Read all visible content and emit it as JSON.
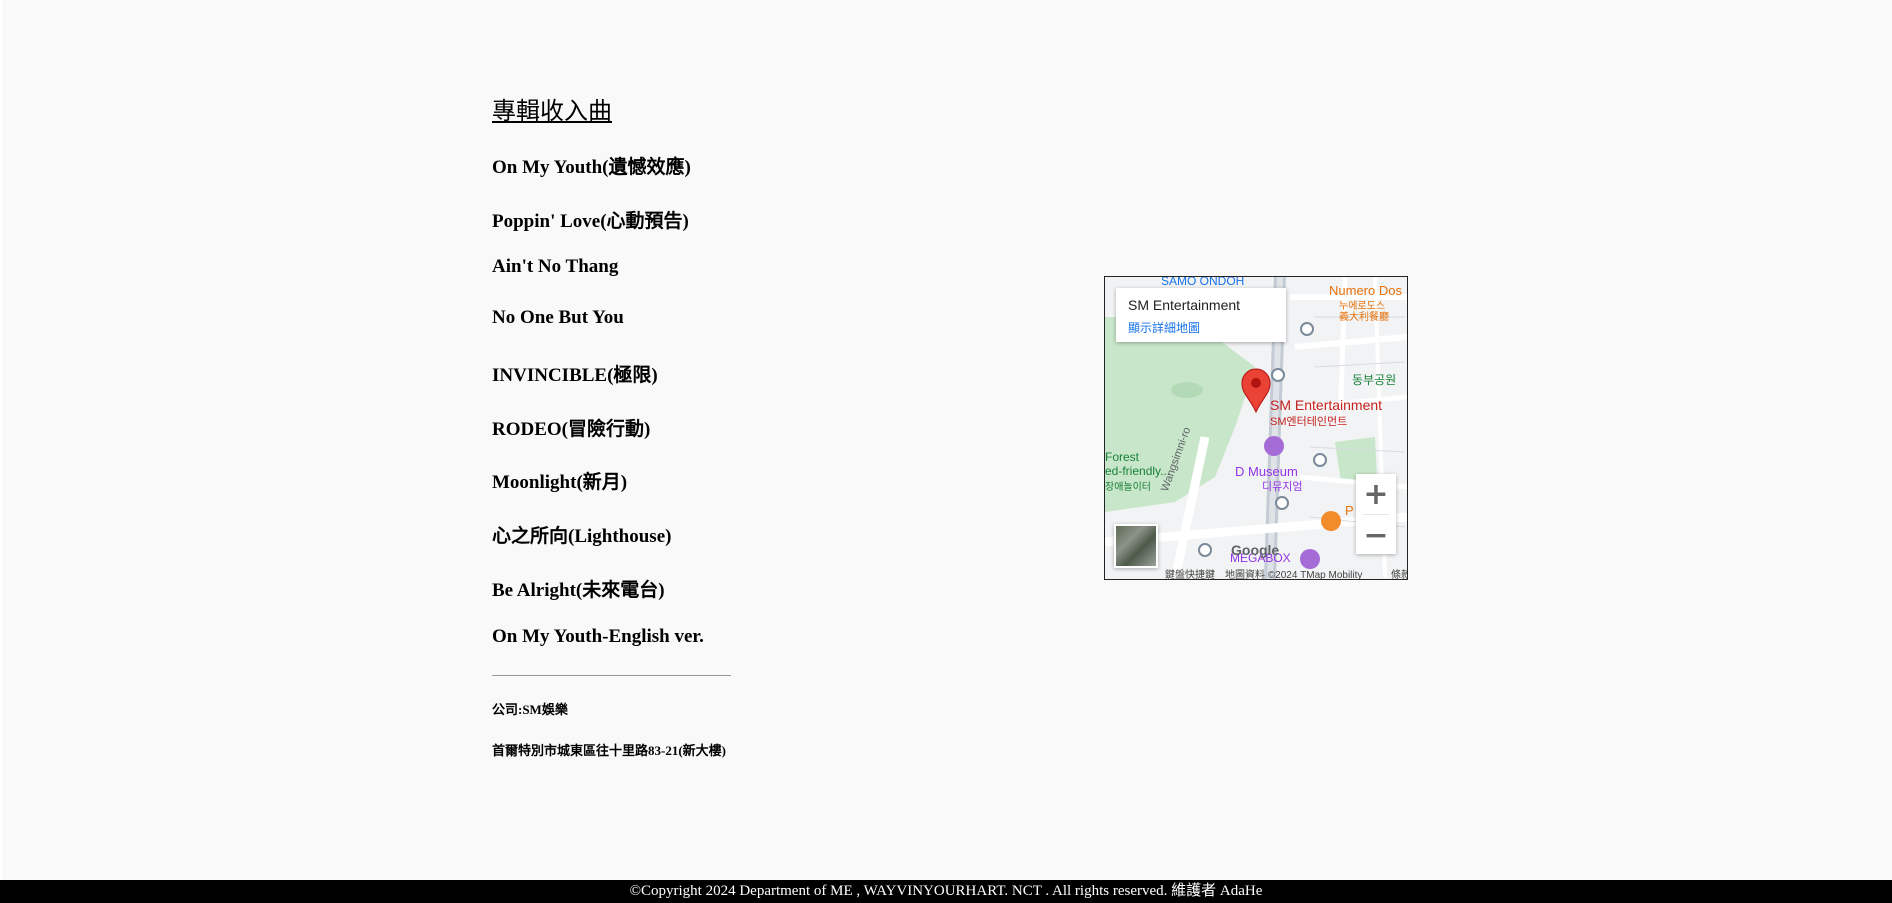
{
  "section_title": "專輯收入曲",
  "tracks": [
    "On My Youth(遺憾效應)",
    "Poppin' Love(心動預告)",
    "Ain't No Thang",
    "No One But You",
    "INVINCIBLE(極限)",
    "RODEO(冒險行動)",
    "Moonlight(新月)",
    "心之所向(Lighthouse)",
    "Be Alright(未來電台)",
    "On My Youth-English ver."
  ],
  "company": "公司:SM娛樂",
  "address": "首爾特別市城東區往十里路83-21(新大樓)",
  "map": {
    "place_title": "SM Entertainment",
    "view_larger_link": "顯示詳細地圖",
    "pin_label": "SM Entertainment",
    "pin_label_korean": "SM엔터테인먼트",
    "label_samo": "SAMO ONDOH",
    "label_numero": "Numero Dos",
    "label_numero_ko": "누에로도스",
    "label_numero_cn": "義大利餐廳",
    "label_park": "동부공원",
    "label_forest": "Forest",
    "label_forest2": "ed-friendly...",
    "label_forest3": "장애놀이터",
    "label_museum": "D Museum",
    "label_museum_ko": "디뮤지엄",
    "label_road": "Wangsimni-ro",
    "label_megabox": "MEGABOX",
    "label_restaurant": "P",
    "google_logo": "Google",
    "shortcuts": "鍵盤快捷鍵",
    "map_data": "地圖資料 ©2024 TMap Mobility",
    "terms": "條款",
    "zoom_in": "+",
    "zoom_out": "−",
    "pin_color": "#ea4335",
    "park_color": "#c8e6c9"
  },
  "footer": "©Copyright 2024 Department of ME , WAYVINYOURHART. NCT . All rights reserved. 維護者 AdaHe"
}
